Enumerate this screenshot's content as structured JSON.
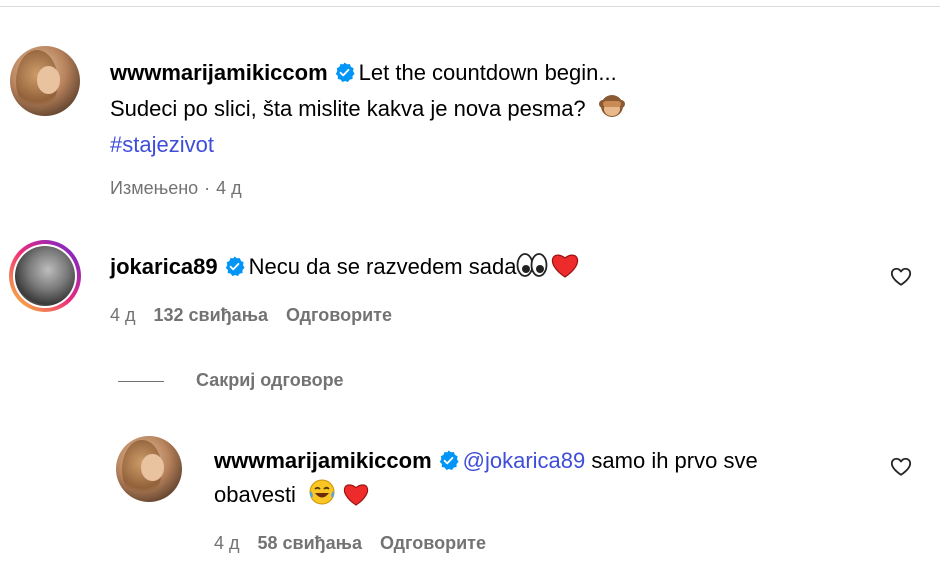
{
  "comments": [
    {
      "username": "wwwmarijamikiccom",
      "text_line1": "Let the countdown begin...",
      "text_line2": "Sudeci po slici, šta mislite kakva je nova pesma?",
      "hashtag": "#stajezivot",
      "edited_label": "Измењено",
      "separator": "·",
      "time": "4 д"
    },
    {
      "username": "jokarica89",
      "text": "Necu da se razvedem sada",
      "time": "4 д",
      "likes": "132 свиђања",
      "reply_label": "Одговорите"
    }
  ],
  "replies_toggle": "Сакриј одговоре",
  "reply": {
    "username": "wwwmarijamikiccom",
    "mention": "@jokarica89",
    "text_line1": "samo ih prvo sve",
    "text_line2": "obavesti",
    "time": "4 д",
    "likes": "58 свиђања",
    "reply_label": "Одговорите"
  },
  "colors": {
    "verified": "#0095f6",
    "link": "#3f4ed8",
    "meta": "#737373",
    "heart_red": "#ed2b2b"
  }
}
